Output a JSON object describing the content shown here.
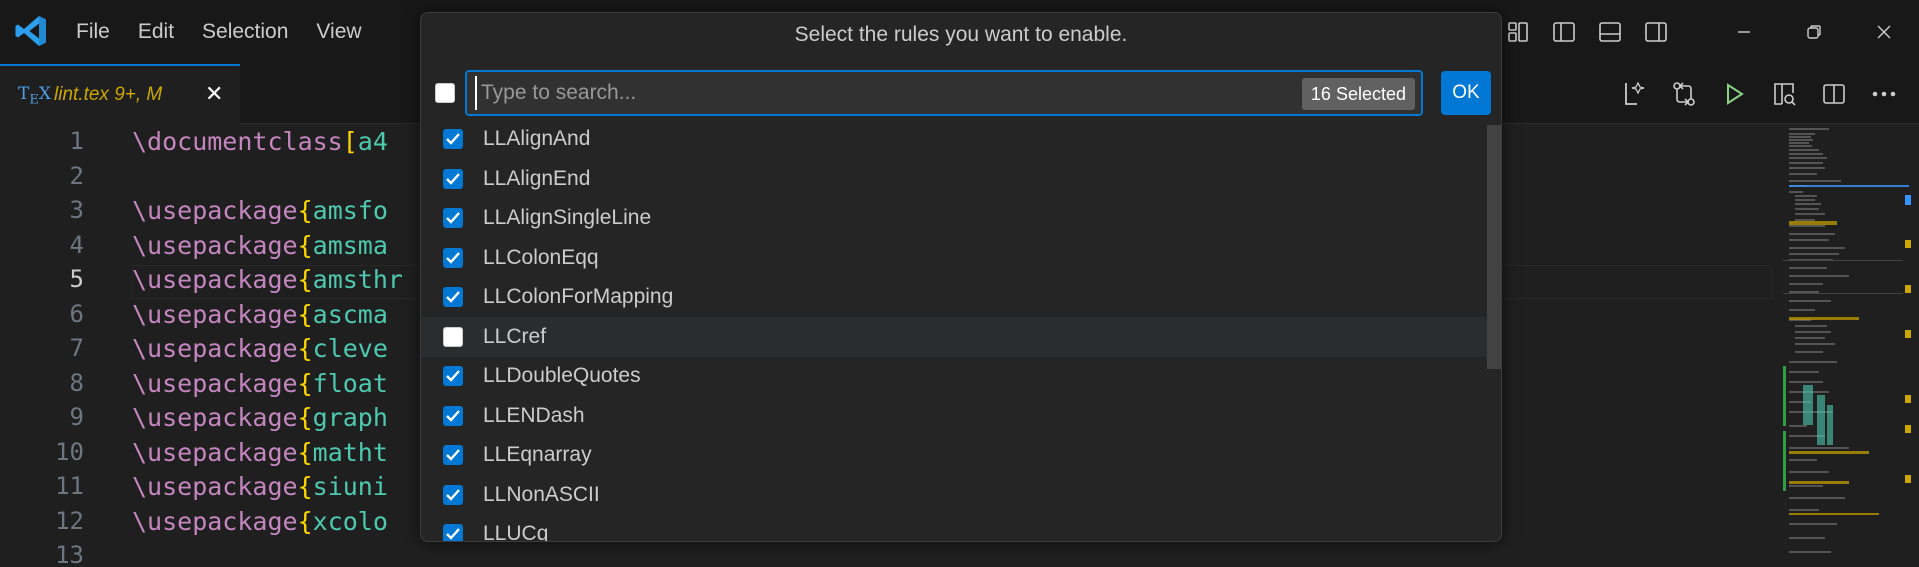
{
  "menu": [
    "File",
    "Edit",
    "Selection",
    "View"
  ],
  "tab": {
    "icon_text": "TEX",
    "filename": "lint.tex",
    "status": "9+, M",
    "close_glyph": "✕"
  },
  "editor": {
    "lines": [
      {
        "num": "1",
        "cmd": "\\documentclass",
        "open": "[",
        "arg": "a4"
      },
      {
        "num": "2",
        "cmd": "",
        "open": "",
        "arg": ""
      },
      {
        "num": "3",
        "cmd": "\\usepackage",
        "open": "{",
        "arg": "amsfo"
      },
      {
        "num": "4",
        "cmd": "\\usepackage",
        "open": "{",
        "arg": "amsma"
      },
      {
        "num": "5",
        "cmd": "\\usepackage",
        "open": "{",
        "arg": "amsthr"
      },
      {
        "num": "6",
        "cmd": "\\usepackage",
        "open": "{",
        "arg": "ascma"
      },
      {
        "num": "7",
        "cmd": "\\usepackage",
        "open": "{",
        "arg": "cleve"
      },
      {
        "num": "8",
        "cmd": "\\usepackage",
        "open": "{",
        "arg": "float"
      },
      {
        "num": "9",
        "cmd": "\\usepackage",
        "open": "{",
        "arg": "graph"
      },
      {
        "num": "10",
        "cmd": "\\usepackage",
        "open": "{",
        "arg": "matht"
      },
      {
        "num": "11",
        "cmd": "\\usepackage",
        "open": "{",
        "arg": "siuni"
      },
      {
        "num": "12",
        "cmd": "\\usepackage",
        "open": "{",
        "arg": "xcolo"
      },
      {
        "num": "13",
        "cmd": "",
        "open": "",
        "arg": ""
      }
    ],
    "active_line": "5"
  },
  "quickpick": {
    "title": "Select the rules you want to enable.",
    "placeholder": "Type to search...",
    "selected_count": "16 Selected",
    "ok_label": "OK",
    "items": [
      {
        "label": "LLAlignAnd",
        "checked": true
      },
      {
        "label": "LLAlignEnd",
        "checked": true
      },
      {
        "label": "LLAlignSingleLine",
        "checked": true
      },
      {
        "label": "LLColonEqq",
        "checked": true
      },
      {
        "label": "LLColonForMapping",
        "checked": true
      },
      {
        "label": "LLCref",
        "checked": false
      },
      {
        "label": "LLDoubleQuotes",
        "checked": true
      },
      {
        "label": "LLENDash",
        "checked": true
      },
      {
        "label": "LLEqnarray",
        "checked": true
      },
      {
        "label": "LLNonASCII",
        "checked": true
      },
      {
        "label": "LLUCq",
        "checked": true
      }
    ]
  },
  "colors": {
    "accent": "#0078d4",
    "background": "#1f1f1f",
    "titlebar": "#181818",
    "keyword": "#c586c0",
    "bracket": "#ffd700",
    "argument": "#4ec9b0",
    "modified": "#cca700"
  },
  "icons": {
    "logo": "vscode-logo-icon",
    "layout": [
      "customize-layout-icon",
      "toggle-primary-sidebar-icon",
      "toggle-panel-icon",
      "toggle-secondary-sidebar-icon"
    ],
    "window": [
      "minimize-icon",
      "restore-icon",
      "close-icon"
    ],
    "actions": [
      "latex-preview-icon",
      "source-control-icon",
      "run-icon",
      "split-preview-icon",
      "split-editor-icon",
      "more-actions-icon"
    ]
  }
}
